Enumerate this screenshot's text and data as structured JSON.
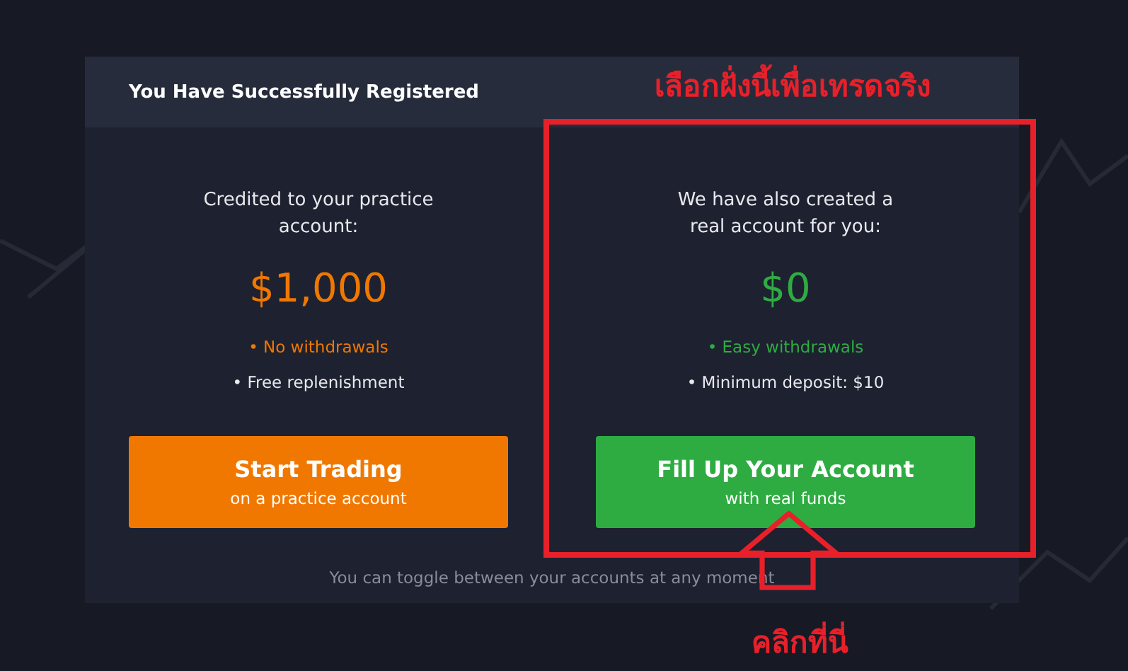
{
  "dialog": {
    "title": "You Have Successfully Registered",
    "accounts": [
      {
        "intro": "Credited to your practice\naccount:",
        "amount": "$1,000",
        "color": "#f07800",
        "features": [
          {
            "text": "• No withdrawals",
            "highlight": true
          },
          {
            "text": "• Free replenishment",
            "highlight": false
          }
        ],
        "button": {
          "label": "Start Trading",
          "sublabel": "on a practice account"
        }
      },
      {
        "intro": "We have also created a\nreal account for you:",
        "amount": "$0",
        "color": "#2eac42",
        "features": [
          {
            "text": "• Easy withdrawals",
            "highlight": true
          },
          {
            "text": "• Minimum deposit: $10",
            "highlight": false
          }
        ],
        "button": {
          "label": "Fill Up Your Account",
          "sublabel": "with real funds"
        }
      }
    ],
    "footer_note": "You can toggle between your accounts at any moment"
  },
  "annotations": {
    "heading": "เลือกฝั่งนี้เพื่อเทรดจริง",
    "callout": "คลิกที่นี่"
  }
}
